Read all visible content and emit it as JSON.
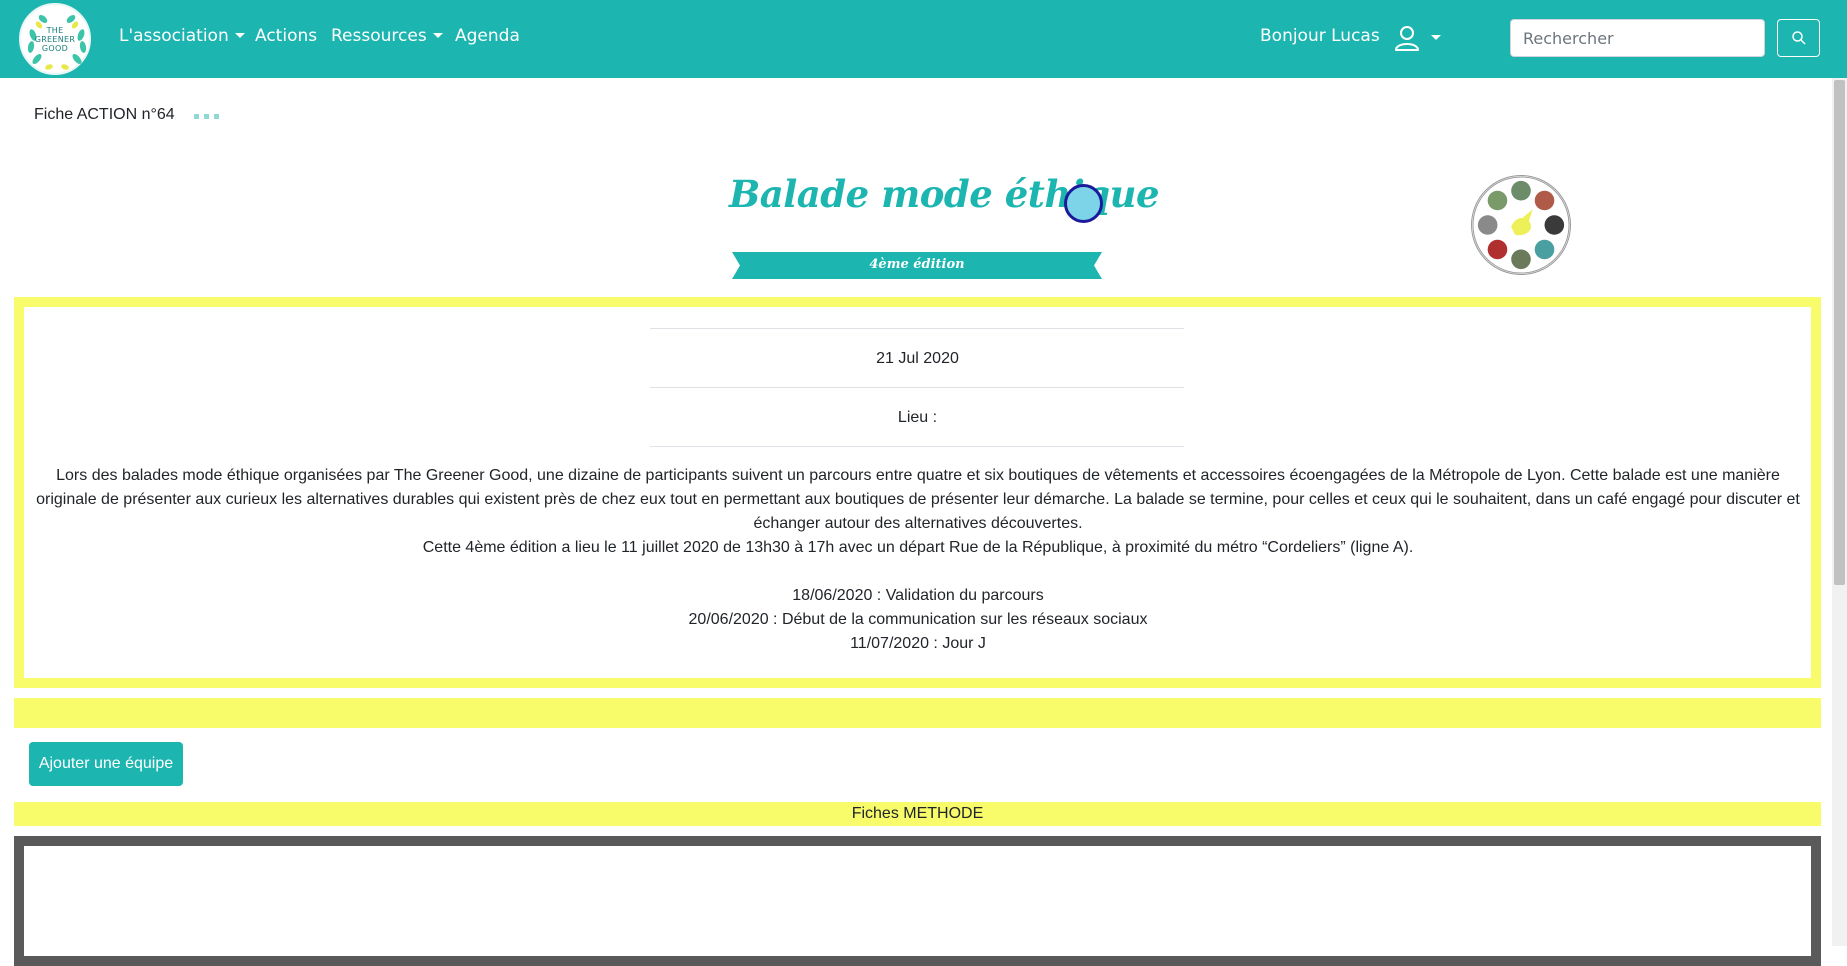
{
  "navbar": {
    "logo_text": [
      "THE",
      "GREENER",
      "GOOD"
    ],
    "items": [
      {
        "label": "L'association",
        "dropdown": true
      },
      {
        "label": "Actions",
        "dropdown": false
      },
      {
        "label": "Ressources",
        "dropdown": true
      },
      {
        "label": "Agenda",
        "dropdown": false
      }
    ],
    "greeting": "Bonjour Lucas",
    "search_placeholder": "Rechercher",
    "color": "#1cb5b0"
  },
  "fiche": {
    "label": "Fiche ACTION n°64",
    "title": "Balade mode éthique",
    "edition": "4ème édition",
    "status_color": "#7dd3e8",
    "date": "21 Jul 2020",
    "lieu_label": "Lieu :",
    "description": [
      "Lors des balades mode éthique organisées par The Greener Good, une dizaine de participants suivent un parcours entre quatre et six boutiques de vêtements et accessoires écoengagées de la Métropole de Lyon. Cette balade est une manière originale de présenter aux curieux les alternatives durables qui existent près de chez eux tout en permettant aux boutiques de présenter leur démarche. La balade se termine, pour celles et ceux qui le souhaitent, dans un café engagé pour discuter et échanger autour des alternatives découvertes.",
      "Cette 4ème édition a lieu le 11 juillet 2020 de 13h30 à 17h avec un départ Rue de la République, à proximité du métro “Cordeliers” (ligne A)."
    ],
    "milestones": [
      "18/06/2020 : Validation du parcours",
      "20/06/2020 : Début de la communication sur les réseaux sociaux",
      "11/07/2020 : Jour J"
    ]
  },
  "buttons": {
    "add_team": "Ajouter une équipe"
  },
  "sections": {
    "methode": "Fiches METHODE"
  },
  "colors": {
    "accent": "#1cb5b0",
    "yellow": "#f8fb6a",
    "grey": "#5a5a5a"
  }
}
